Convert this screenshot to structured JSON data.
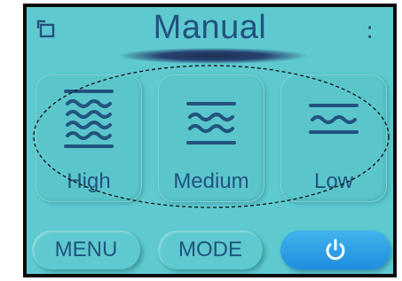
{
  "header": {
    "title": "Manual",
    "more_label": ":"
  },
  "modes": [
    {
      "label": "High",
      "icon": "high-waves-icon"
    },
    {
      "label": "Medium",
      "icon": "medium-waves-icon"
    },
    {
      "label": "Low",
      "icon": "low-waves-icon"
    }
  ],
  "bottom": {
    "menu_label": "MENU",
    "mode_label": "MODE",
    "power_icon": "power-icon"
  },
  "colors": {
    "screen_bg": "#5ecad0",
    "text": "#22537e",
    "power_button": "#2b9fe6"
  }
}
